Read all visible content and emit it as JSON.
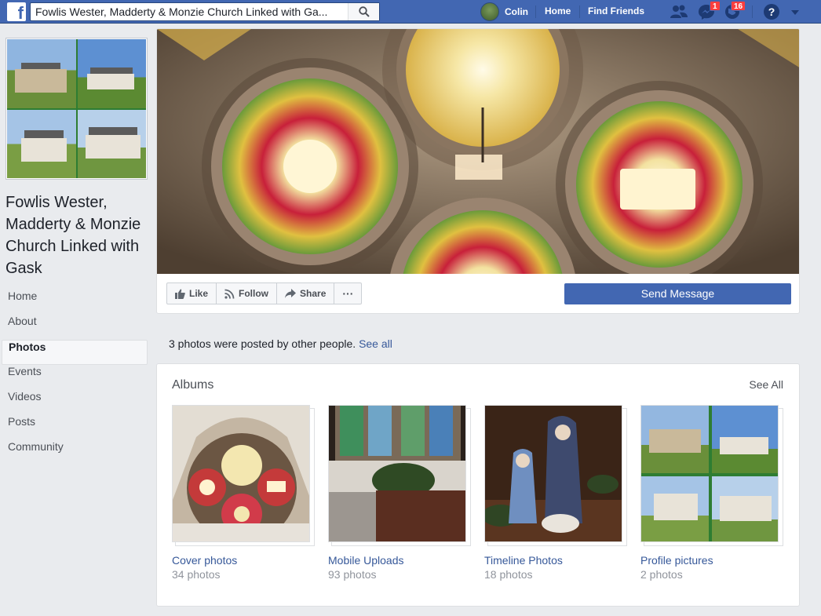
{
  "topbar": {
    "search_value": "Fowlis Wester, Madderty & Monzie Church Linked with Ga...",
    "user_name": "Colin",
    "home_label": "Home",
    "find_friends_label": "Find Friends",
    "messages_badge": "1",
    "notifications_badge": "16"
  },
  "page": {
    "name": "Fowlis Wester, Madderty & Monzie Church Linked with Gask"
  },
  "side_nav": {
    "items": [
      {
        "label": "Home"
      },
      {
        "label": "About"
      },
      {
        "label": "Photos"
      },
      {
        "label": "Events"
      },
      {
        "label": "Videos"
      },
      {
        "label": "Posts"
      },
      {
        "label": "Community"
      }
    ]
  },
  "actions": {
    "like_label": "Like",
    "follow_label": "Follow",
    "share_label": "Share",
    "more_label": "···",
    "send_message_label": "Send Message"
  },
  "others_notice": {
    "text": "3 photos were posted by other people.",
    "link": "See all"
  },
  "albums": {
    "title": "Albums",
    "see_all": "See All",
    "items": [
      {
        "name": "Cover photos",
        "count": "34 photos"
      },
      {
        "name": "Mobile Uploads",
        "count": "93 photos"
      },
      {
        "name": "Timeline Photos",
        "count": "18 photos"
      },
      {
        "name": "Profile pictures",
        "count": "2 photos"
      }
    ]
  },
  "colors": {
    "brand": "#4267b2",
    "link": "#365899",
    "background": "#e9ebee",
    "badge": "#fa3e3e"
  }
}
